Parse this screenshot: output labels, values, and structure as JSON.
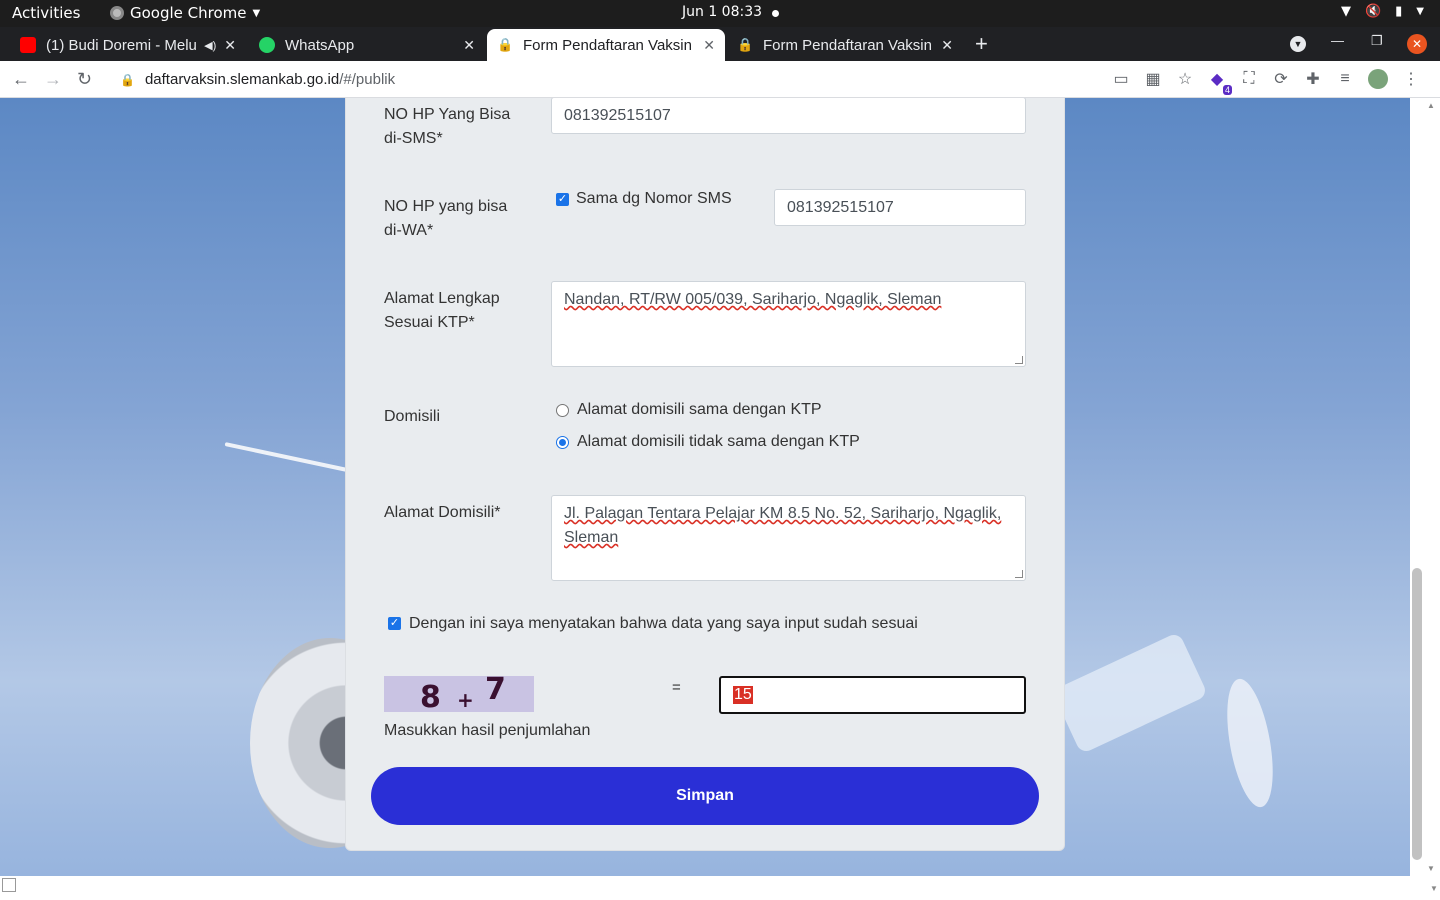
{
  "topbar": {
    "activities": "Activities",
    "app_name": "Google Chrome",
    "clock": "Jun 1  08:33"
  },
  "tabs": [
    {
      "title": "(1) Budi Doremi - Melu",
      "icon": "youtube-icon",
      "muted": true
    },
    {
      "title": "WhatsApp",
      "icon": "whatsapp-icon"
    },
    {
      "title": "Form Pendaftaran Vaksin",
      "icon": "lock-icon",
      "active": true
    },
    {
      "title": "Form Pendaftaran Vaksin",
      "icon": "lock-icon"
    }
  ],
  "address_bar": {
    "host": "daftarvaksin.slemankab.go.id",
    "path": "/#/publik"
  },
  "form": {
    "sms_label": "NO HP Yang Bisa di-SMS*",
    "sms_value": "081392515107",
    "wa_label": "NO HP yang bisa di-WA*",
    "same_as_sms_label": "Sama dg Nomor SMS",
    "same_as_sms_checked": true,
    "wa_value": "081392515107",
    "ktp_address_label": "Alamat Lengkap Sesuai KTP*",
    "ktp_address_value": "Nandan, RT/RW 005/039, Sariharjo, Ngaglik, Sleman",
    "domisili_label": "Domisili",
    "domisili_options": [
      {
        "label": "Alamat domisili sama dengan KTP",
        "selected": false
      },
      {
        "label": "Alamat domisili tidak sama dengan KTP",
        "selected": true
      }
    ],
    "domisili_address_label": "Alamat Domisili*",
    "domisili_address_value": "Jl. Palagan Tentara Pelajar KM 8.5 No. 52, Sariharjo, Ngaglik, Sleman",
    "declaration_label": "Dengan ini saya menyatakan bahwa data yang saya input sudah sesuai",
    "declaration_checked": true,
    "captcha_a": "8",
    "captcha_op": "+",
    "captcha_b": "7",
    "captcha_equals": "=",
    "captcha_answer": "15",
    "captcha_hint": "Masukkan hasil penjumlahan",
    "submit_label": "Simpan"
  },
  "colors": {
    "submit_bg": "#2a2fd6",
    "card_bg": "#e9ecef",
    "checkbox": "#1a73e8"
  }
}
